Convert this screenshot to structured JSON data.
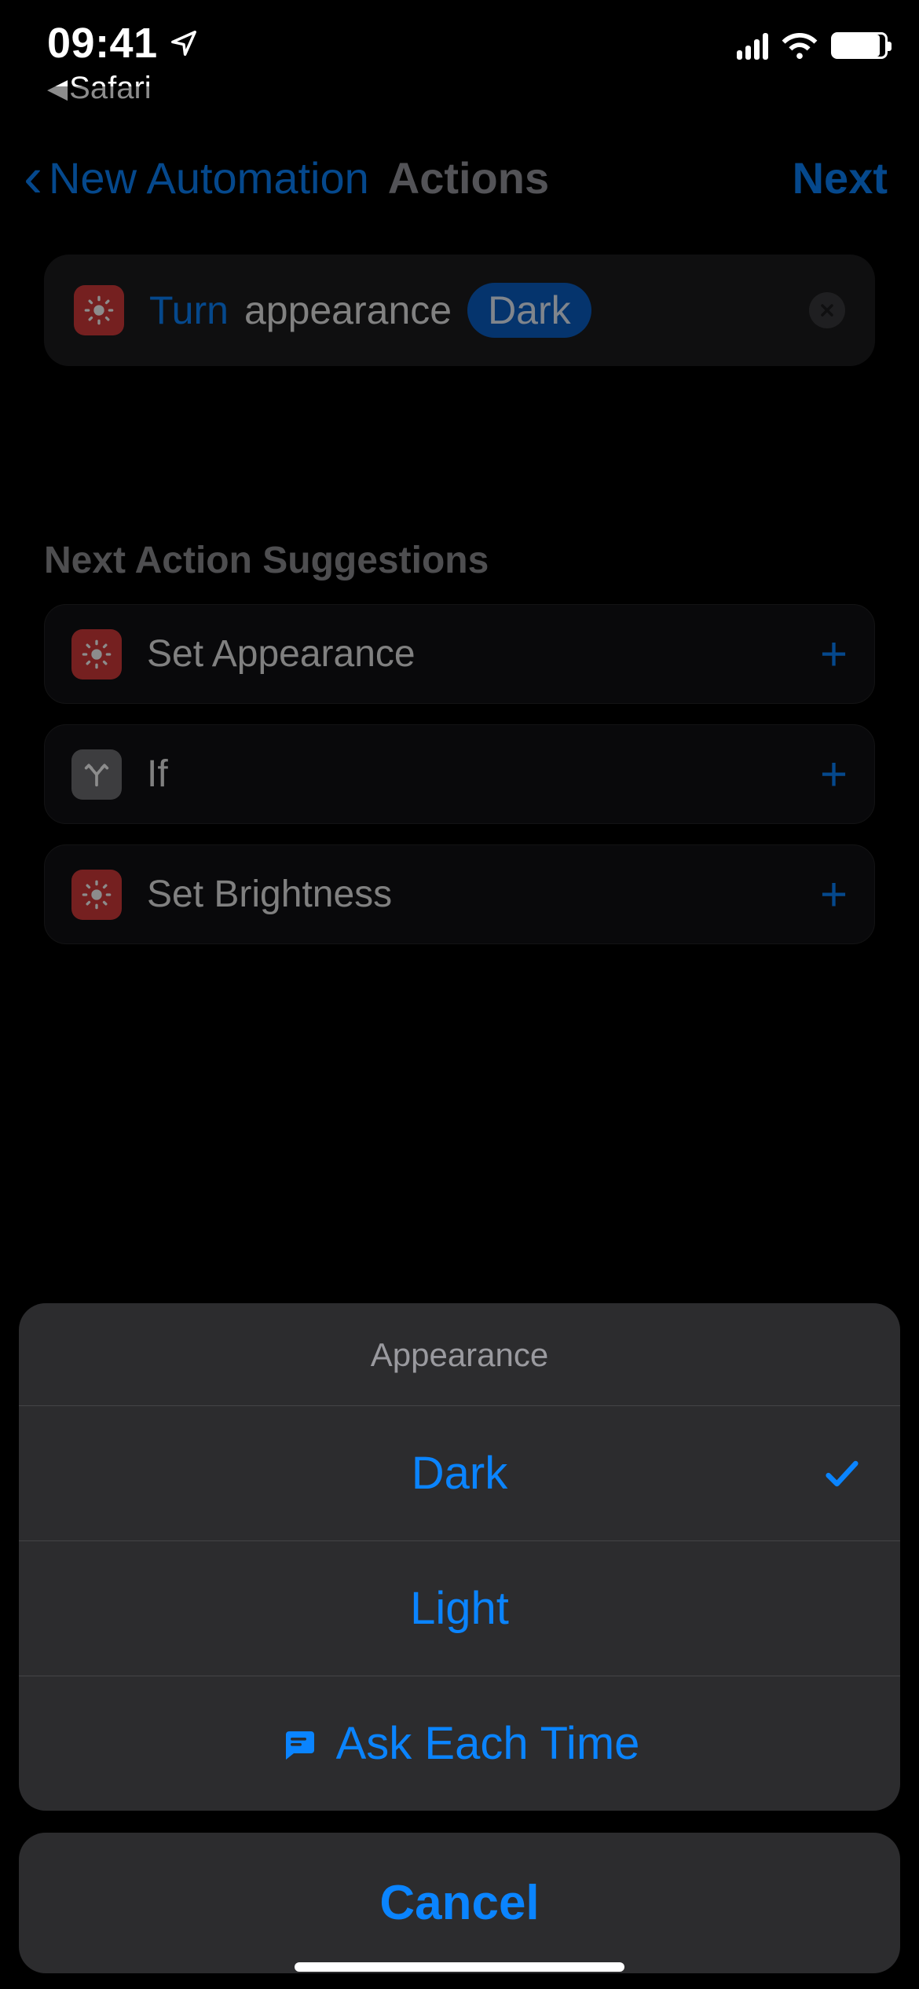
{
  "status": {
    "time": "09:41",
    "back_app": "Safari"
  },
  "nav": {
    "back_label": "New Automation",
    "title": "Actions",
    "next_label": "Next"
  },
  "action": {
    "verb": "Turn",
    "noun": "appearance",
    "value_token": "Dark",
    "icon": "brightness-icon"
  },
  "suggestions": {
    "header": "Next Action Suggestions",
    "items": [
      {
        "label": "Set Appearance",
        "icon": "brightness-icon",
        "icon_bg": "#d63b3b"
      },
      {
        "label": "If",
        "icon": "branch-icon",
        "icon_bg": "#707074"
      },
      {
        "label": "Set Brightness",
        "icon": "brightness-icon",
        "icon_bg": "#d63b3b"
      }
    ]
  },
  "picker": {
    "title": "Appearance",
    "options": [
      {
        "label": "Dark",
        "selected": true
      },
      {
        "label": "Light",
        "selected": false
      }
    ],
    "ask_label": "Ask Each Time",
    "cancel_label": "Cancel"
  },
  "colors": {
    "accent": "#0a84ff",
    "brightness_red": "#d63b3b",
    "gray": "#8e8e93"
  }
}
